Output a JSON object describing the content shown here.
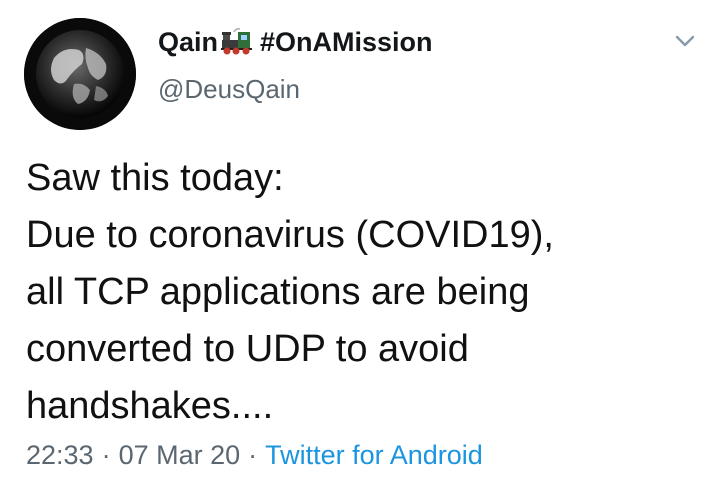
{
  "header": {
    "display_name": "Qain",
    "emoji_icon": "steam-locomotive-emoji-icon",
    "hashtag": "#OnAMission",
    "handle": "@DeusQain",
    "menu_icon": "chevron-down-icon"
  },
  "tweet": {
    "lines": [
      "Saw this today:",
      "Due to coronavirus (COVID19),",
      "all TCP applications are being",
      "converted to UDP to avoid",
      "handshakes...."
    ]
  },
  "meta": {
    "time": "22:33",
    "separator": "·",
    "date": "07 Mar 20",
    "source": "Twitter for Android",
    "link_color": "#1b95e0"
  }
}
